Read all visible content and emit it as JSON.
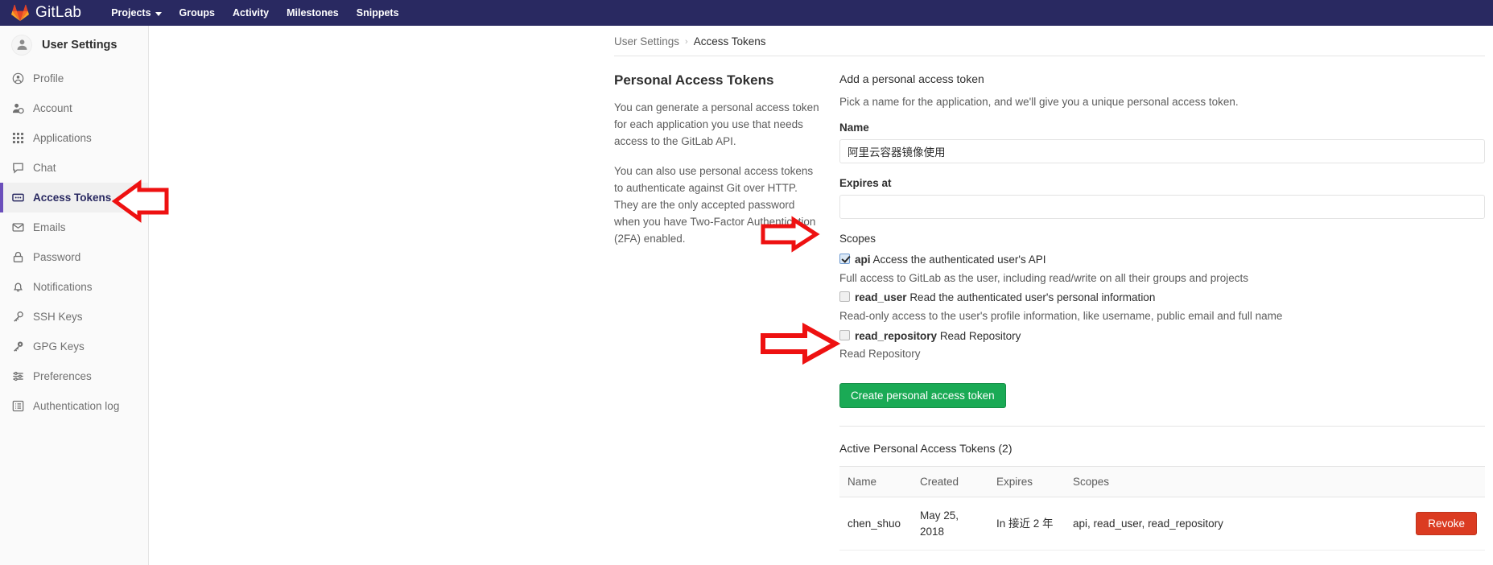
{
  "navbar": {
    "brand": "GitLab",
    "logo_icon": "gitlab-tanuki-icon",
    "links": [
      {
        "label": "Projects",
        "has_caret": true
      },
      {
        "label": "Groups",
        "has_caret": false
      },
      {
        "label": "Activity",
        "has_caret": false
      },
      {
        "label": "Milestones",
        "has_caret": false
      },
      {
        "label": "Snippets",
        "has_caret": false
      }
    ]
  },
  "sidebar": {
    "title": "User Settings",
    "avatar_icon": "user-avatar-icon",
    "items": [
      {
        "label": "Profile",
        "icon": "profile-icon",
        "active": false
      },
      {
        "label": "Account",
        "icon": "account-gear-icon",
        "active": false
      },
      {
        "label": "Applications",
        "icon": "applications-grid-icon",
        "active": false
      },
      {
        "label": "Chat",
        "icon": "chat-bubble-icon",
        "active": false
      },
      {
        "label": "Access Tokens",
        "icon": "access-token-icon",
        "active": true
      },
      {
        "label": "Emails",
        "icon": "envelope-icon",
        "active": false
      },
      {
        "label": "Password",
        "icon": "lock-icon",
        "active": false
      },
      {
        "label": "Notifications",
        "icon": "bell-icon",
        "active": false
      },
      {
        "label": "SSH Keys",
        "icon": "key-icon",
        "active": false
      },
      {
        "label": "GPG Keys",
        "icon": "key-icon",
        "active": false
      },
      {
        "label": "Preferences",
        "icon": "sliders-icon",
        "active": false
      },
      {
        "label": "Authentication log",
        "icon": "list-log-icon",
        "active": false
      }
    ]
  },
  "breadcrumb": {
    "parent": "User Settings",
    "separator": "›",
    "current": "Access Tokens"
  },
  "info": {
    "heading": "Personal Access Tokens",
    "paragraph_1": "You can generate a personal access token for each application you use that needs access to the GitLab API.",
    "paragraph_2": "You can also use personal access tokens to authenticate against Git over HTTP. They are the only accepted password when you have Two-Factor Authentication (2FA) enabled."
  },
  "form": {
    "title": "Add a personal access token",
    "subtitle": "Pick a name for the application, and we'll give you a unique personal access token.",
    "name_label": "Name",
    "name_value": "阿里云容器镜像使用",
    "name_placeholder": "",
    "expires_label": "Expires at",
    "expires_value": "",
    "expires_placeholder": "",
    "scopes_label": "Scopes",
    "scopes": [
      {
        "name": "api",
        "label": "Access the authenticated user's API",
        "checked": true,
        "help": "Full access to GitLab as the user, including read/write on all their groups and projects"
      },
      {
        "name": "read_user",
        "label": "Read the authenticated user's personal information",
        "checked": false,
        "help": "Read-only access to the user's profile information, like username, public email and full name"
      },
      {
        "name": "read_repository",
        "label": "Read Repository",
        "checked": false,
        "help": "Read Repository"
      }
    ],
    "submit_label": "Create personal access token",
    "submit_color": "#1aaa55"
  },
  "active_tokens": {
    "title": "Active Personal Access Tokens (2)",
    "columns": [
      "Name",
      "Created",
      "Expires",
      "Scopes",
      ""
    ],
    "rows": [
      {
        "name": "chen_shuo",
        "created": "May 25, 2018",
        "expires": "In 接近 2 年",
        "scopes": "api, read_user, read_repository",
        "action_label": "Revoke",
        "action_color": "#db3b21"
      }
    ]
  },
  "annotations": {
    "arrow_color": "#ee1111",
    "arrows": [
      {
        "name": "arrow-to-access-tokens",
        "points_to": "Access Tokens"
      },
      {
        "name": "arrow-to-api-scope",
        "points_to": "api scope checkbox"
      },
      {
        "name": "arrow-to-create-token-button",
        "points_to": "Create personal access token"
      }
    ]
  }
}
